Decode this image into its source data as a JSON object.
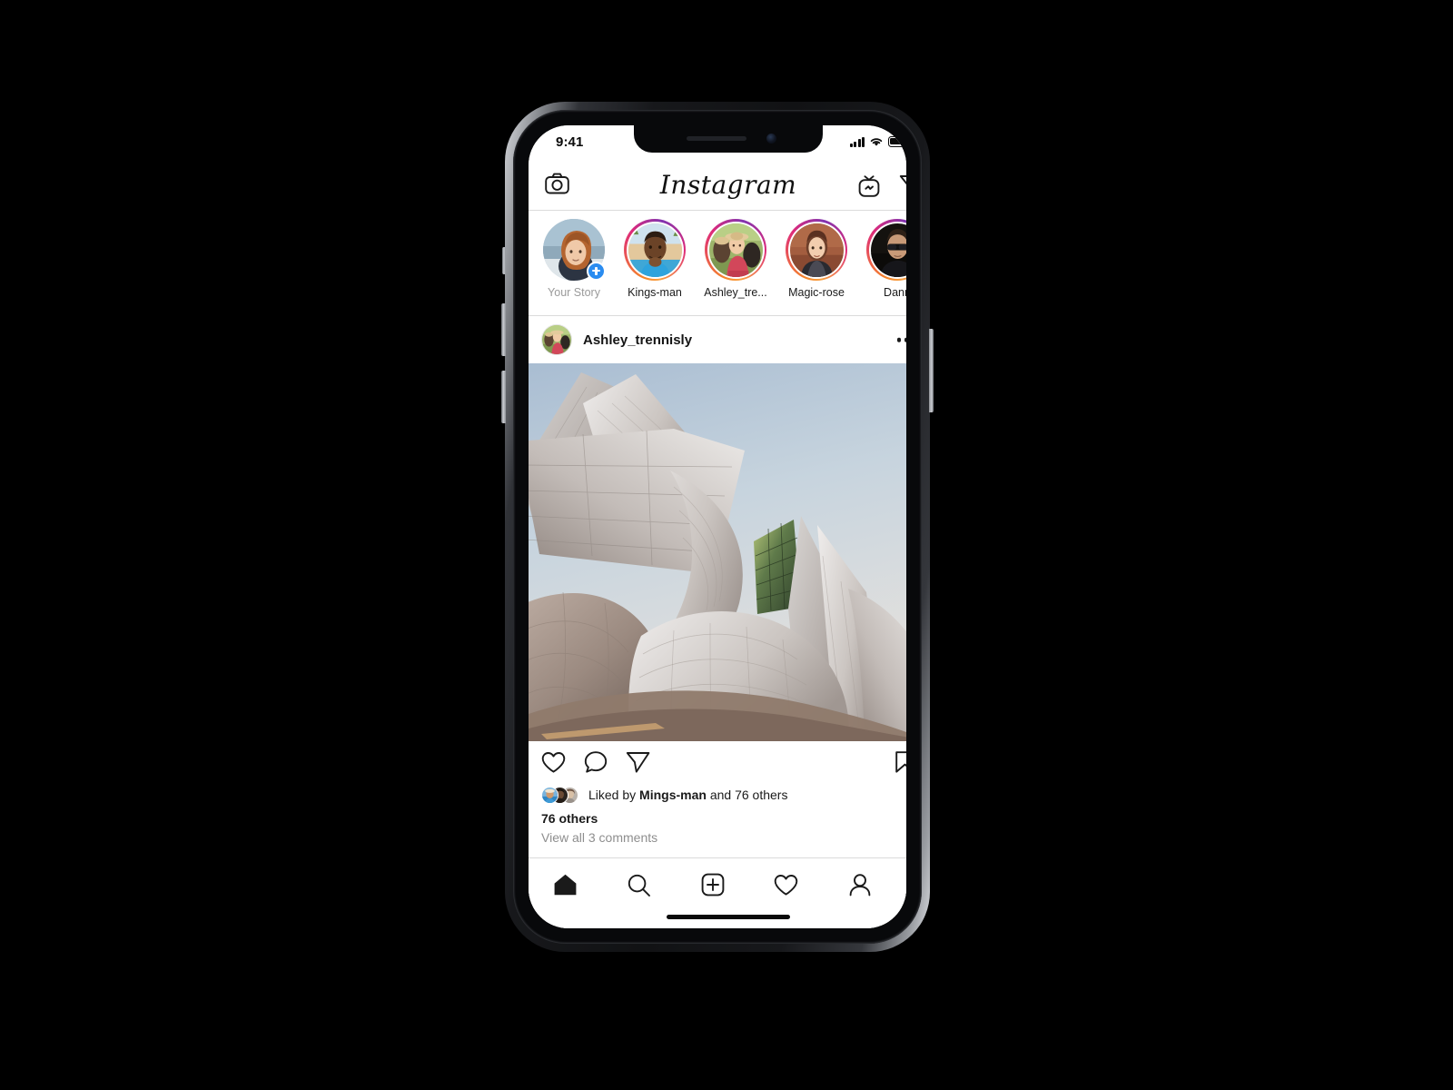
{
  "device": {
    "name": "iphone-x",
    "frame_color": "#17181b"
  },
  "status_bar": {
    "time": "9:41",
    "signal_icon": "signal-bars-icon",
    "wifi_icon": "wifi-icon",
    "battery_icon": "battery-icon"
  },
  "app_header": {
    "title": "Instagram",
    "camera_icon": "camera-icon",
    "igtv_icon": "igtv-icon",
    "direct_message_icon": "send-icon"
  },
  "stories": [
    {
      "label": "Your Story",
      "has_ring": false,
      "is_own": true,
      "add_badge": "plus-badge"
    },
    {
      "label": "Kings-man",
      "has_ring": true,
      "is_own": false
    },
    {
      "label": "Ashley_tre...",
      "has_ring": true,
      "is_own": false
    },
    {
      "label": "Magic-rose",
      "has_ring": true,
      "is_own": false
    },
    {
      "label": "Dann",
      "has_ring": true,
      "is_own": false
    }
  ],
  "post": {
    "username": "Ashley_trennisly",
    "more_options_icon": "more-options-icon",
    "photo_alt": "walt-disney-concert-hall-architecture",
    "actions": {
      "like_icon": "heart-icon",
      "comment_icon": "comment-bubble-icon",
      "share_icon": "send-icon",
      "save_icon": "bookmark-icon"
    },
    "liked_by_prefix": "Liked by ",
    "liked_by_user": "Mings-man",
    "liked_by_suffix": " and 76 others",
    "others_count_line": "76 others",
    "view_comments": "View all 3 comments"
  },
  "bottom_nav": [
    {
      "name": "home",
      "icon": "home-icon",
      "active": true
    },
    {
      "name": "search",
      "icon": "search-icon",
      "active": false
    },
    {
      "name": "add-post",
      "icon": "plus-square-icon",
      "active": false
    },
    {
      "name": "activity",
      "icon": "heart-icon",
      "active": false
    },
    {
      "name": "profile",
      "icon": "person-icon",
      "active": false
    }
  ],
  "colors": {
    "background": "#000000",
    "screen_bg": "#ffffff",
    "divider": "#dbdbdb",
    "text_primary": "#1a1a1a",
    "text_muted": "#8e8e8e",
    "accent_blue": "#2a8cf0",
    "story_gradient_start": "#f58529",
    "story_gradient_mid": "#dd2a7b",
    "story_gradient_end": "#8134af"
  }
}
